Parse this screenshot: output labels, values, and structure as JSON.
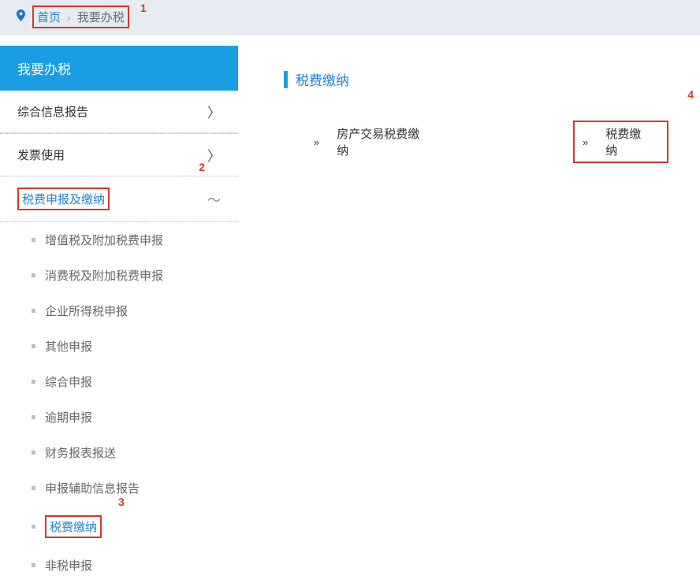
{
  "breadcrumb": {
    "home": "首页",
    "sep": "›",
    "current": "我要办税"
  },
  "sidebar": {
    "title": "我要办税",
    "items": [
      {
        "label": "综合信息报告",
        "expanded": false
      },
      {
        "label": "发票使用",
        "expanded": false
      },
      {
        "label": "税费申报及缴纳",
        "expanded": true
      }
    ],
    "subitems": [
      {
        "label": "增值税及附加税费申报"
      },
      {
        "label": "消费税及附加税费申报"
      },
      {
        "label": "企业所得税申报"
      },
      {
        "label": "其他申报"
      },
      {
        "label": "综合申报"
      },
      {
        "label": "逾期申报"
      },
      {
        "label": "财务报表报送"
      },
      {
        "label": "申报辅助信息报告"
      },
      {
        "label": "税费缴纳"
      },
      {
        "label": "非税申报"
      }
    ]
  },
  "content": {
    "heading": "税费缴纳",
    "links": [
      {
        "label": "房产交易税费缴纳"
      },
      {
        "label": "税费缴纳"
      }
    ]
  },
  "annotations": {
    "one": "1",
    "two": "2",
    "three": "3",
    "four": "4"
  },
  "glyph": {
    "chevron": "〉",
    "expand": "〜",
    "bullet": "»"
  }
}
